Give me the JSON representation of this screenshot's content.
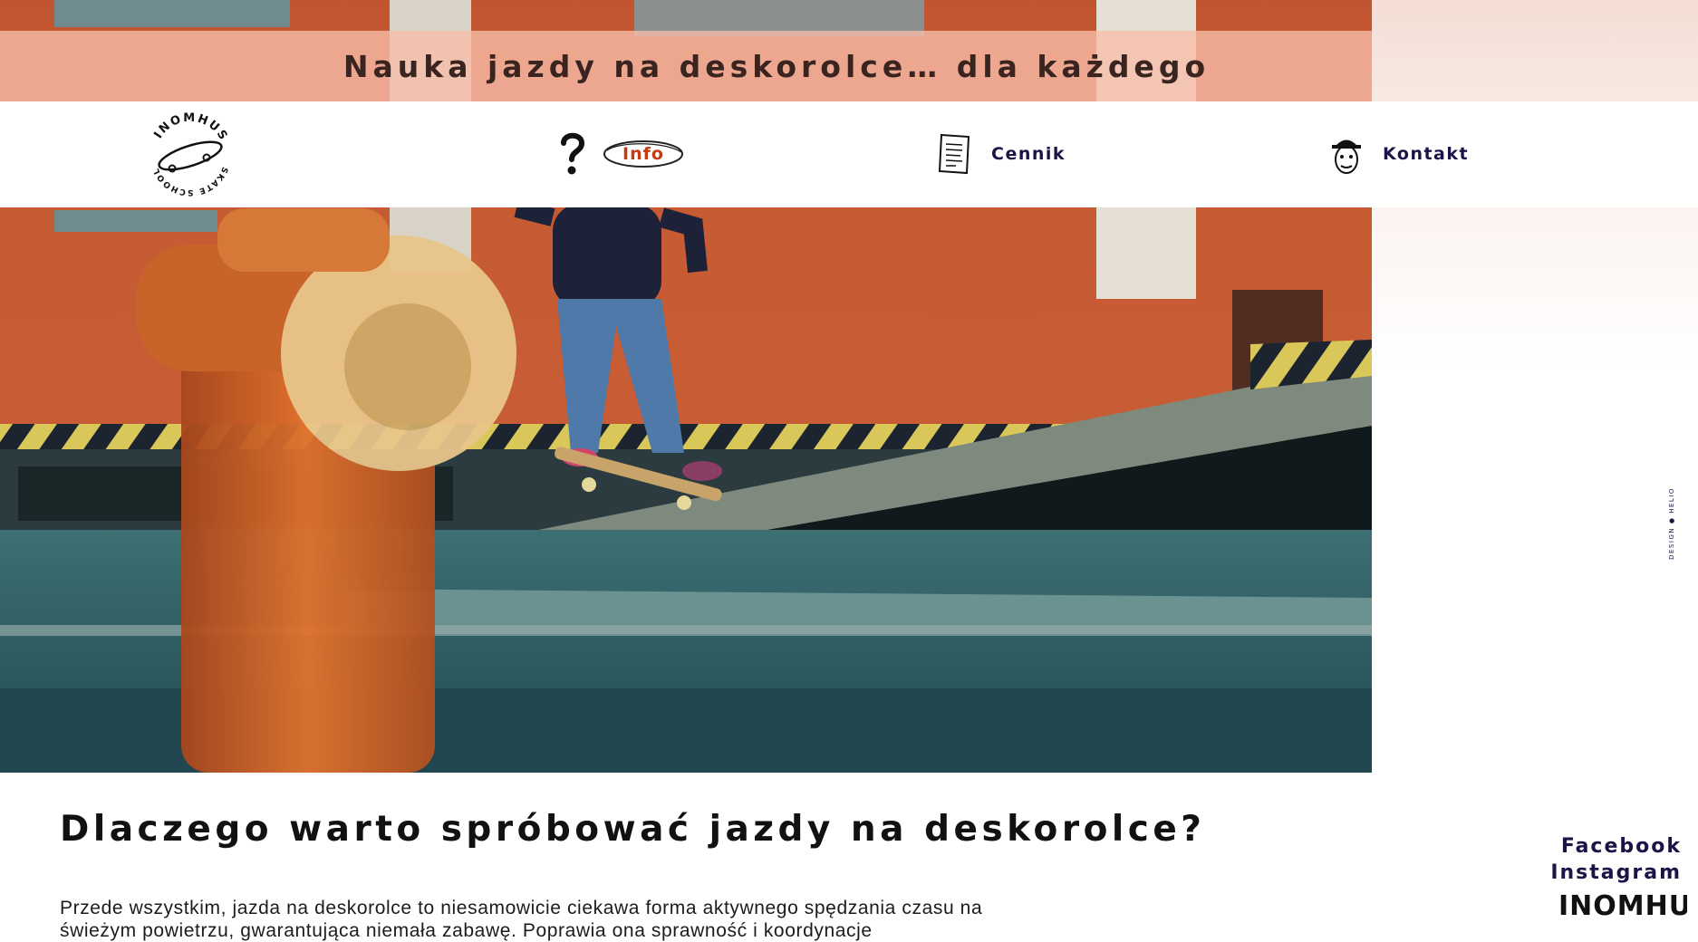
{
  "header": {
    "tagline": "Nauka jazdy na deskorolce… dla każdego"
  },
  "logo": {
    "icon": "skate-school-logo-icon",
    "text_top": "INOMHUS",
    "text_bottom": "SKATE SCHOOL"
  },
  "nav": {
    "items": [
      {
        "label": "Info",
        "icon": "question-mark-icon",
        "active": true
      },
      {
        "label": "Cennik",
        "icon": "price-list-document-icon",
        "active": false
      },
      {
        "label": "Kontakt",
        "icon": "face-with-hat-icon",
        "active": false
      }
    ]
  },
  "credit": "DESIGN ● HELIO",
  "content": {
    "heading": "Dlaczego warto spróbować jazdy na deskorolce?",
    "paragraph": "Przede wszystkim, jazda na deskorolce to niesamowicie ciekawa forma aktywnego spędzania czasu na świeżym powietrzu, gwarantująca niemała zabawę. Poprawia ona sprawność i koordynacje"
  },
  "social": {
    "facebook": "Facebook",
    "instagram": "Instagram",
    "brand": "INOMHUS"
  },
  "colors": {
    "accent_navy": "#1b1446",
    "info_red": "#c43a12",
    "tagline_band": "#f8beaa"
  }
}
